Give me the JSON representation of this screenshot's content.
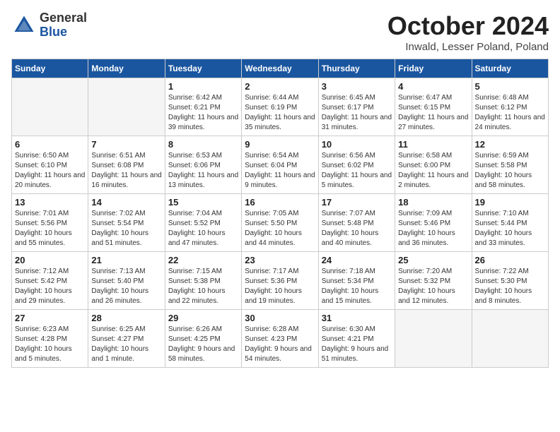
{
  "header": {
    "logo_general": "General",
    "logo_blue": "Blue",
    "month": "October 2024",
    "location": "Inwald, Lesser Poland, Poland"
  },
  "weekdays": [
    "Sunday",
    "Monday",
    "Tuesday",
    "Wednesday",
    "Thursday",
    "Friday",
    "Saturday"
  ],
  "weeks": [
    [
      {
        "day": "",
        "empty": true
      },
      {
        "day": "",
        "empty": true
      },
      {
        "day": "1",
        "sunrise": "Sunrise: 6:42 AM",
        "sunset": "Sunset: 6:21 PM",
        "daylight": "Daylight: 11 hours and 39 minutes."
      },
      {
        "day": "2",
        "sunrise": "Sunrise: 6:44 AM",
        "sunset": "Sunset: 6:19 PM",
        "daylight": "Daylight: 11 hours and 35 minutes."
      },
      {
        "day": "3",
        "sunrise": "Sunrise: 6:45 AM",
        "sunset": "Sunset: 6:17 PM",
        "daylight": "Daylight: 11 hours and 31 minutes."
      },
      {
        "day": "4",
        "sunrise": "Sunrise: 6:47 AM",
        "sunset": "Sunset: 6:15 PM",
        "daylight": "Daylight: 11 hours and 27 minutes."
      },
      {
        "day": "5",
        "sunrise": "Sunrise: 6:48 AM",
        "sunset": "Sunset: 6:12 PM",
        "daylight": "Daylight: 11 hours and 24 minutes."
      }
    ],
    [
      {
        "day": "6",
        "sunrise": "Sunrise: 6:50 AM",
        "sunset": "Sunset: 6:10 PM",
        "daylight": "Daylight: 11 hours and 20 minutes."
      },
      {
        "day": "7",
        "sunrise": "Sunrise: 6:51 AM",
        "sunset": "Sunset: 6:08 PM",
        "daylight": "Daylight: 11 hours and 16 minutes."
      },
      {
        "day": "8",
        "sunrise": "Sunrise: 6:53 AM",
        "sunset": "Sunset: 6:06 PM",
        "daylight": "Daylight: 11 hours and 13 minutes."
      },
      {
        "day": "9",
        "sunrise": "Sunrise: 6:54 AM",
        "sunset": "Sunset: 6:04 PM",
        "daylight": "Daylight: 11 hours and 9 minutes."
      },
      {
        "day": "10",
        "sunrise": "Sunrise: 6:56 AM",
        "sunset": "Sunset: 6:02 PM",
        "daylight": "Daylight: 11 hours and 5 minutes."
      },
      {
        "day": "11",
        "sunrise": "Sunrise: 6:58 AM",
        "sunset": "Sunset: 6:00 PM",
        "daylight": "Daylight: 11 hours and 2 minutes."
      },
      {
        "day": "12",
        "sunrise": "Sunrise: 6:59 AM",
        "sunset": "Sunset: 5:58 PM",
        "daylight": "Daylight: 10 hours and 58 minutes."
      }
    ],
    [
      {
        "day": "13",
        "sunrise": "Sunrise: 7:01 AM",
        "sunset": "Sunset: 5:56 PM",
        "daylight": "Daylight: 10 hours and 55 minutes."
      },
      {
        "day": "14",
        "sunrise": "Sunrise: 7:02 AM",
        "sunset": "Sunset: 5:54 PM",
        "daylight": "Daylight: 10 hours and 51 minutes."
      },
      {
        "day": "15",
        "sunrise": "Sunrise: 7:04 AM",
        "sunset": "Sunset: 5:52 PM",
        "daylight": "Daylight: 10 hours and 47 minutes."
      },
      {
        "day": "16",
        "sunrise": "Sunrise: 7:05 AM",
        "sunset": "Sunset: 5:50 PM",
        "daylight": "Daylight: 10 hours and 44 minutes."
      },
      {
        "day": "17",
        "sunrise": "Sunrise: 7:07 AM",
        "sunset": "Sunset: 5:48 PM",
        "daylight": "Daylight: 10 hours and 40 minutes."
      },
      {
        "day": "18",
        "sunrise": "Sunrise: 7:09 AM",
        "sunset": "Sunset: 5:46 PM",
        "daylight": "Daylight: 10 hours and 36 minutes."
      },
      {
        "day": "19",
        "sunrise": "Sunrise: 7:10 AM",
        "sunset": "Sunset: 5:44 PM",
        "daylight": "Daylight: 10 hours and 33 minutes."
      }
    ],
    [
      {
        "day": "20",
        "sunrise": "Sunrise: 7:12 AM",
        "sunset": "Sunset: 5:42 PM",
        "daylight": "Daylight: 10 hours and 29 minutes."
      },
      {
        "day": "21",
        "sunrise": "Sunrise: 7:13 AM",
        "sunset": "Sunset: 5:40 PM",
        "daylight": "Daylight: 10 hours and 26 minutes."
      },
      {
        "day": "22",
        "sunrise": "Sunrise: 7:15 AM",
        "sunset": "Sunset: 5:38 PM",
        "daylight": "Daylight: 10 hours and 22 minutes."
      },
      {
        "day": "23",
        "sunrise": "Sunrise: 7:17 AM",
        "sunset": "Sunset: 5:36 PM",
        "daylight": "Daylight: 10 hours and 19 minutes."
      },
      {
        "day": "24",
        "sunrise": "Sunrise: 7:18 AM",
        "sunset": "Sunset: 5:34 PM",
        "daylight": "Daylight: 10 hours and 15 minutes."
      },
      {
        "day": "25",
        "sunrise": "Sunrise: 7:20 AM",
        "sunset": "Sunset: 5:32 PM",
        "daylight": "Daylight: 10 hours and 12 minutes."
      },
      {
        "day": "26",
        "sunrise": "Sunrise: 7:22 AM",
        "sunset": "Sunset: 5:30 PM",
        "daylight": "Daylight: 10 hours and 8 minutes."
      }
    ],
    [
      {
        "day": "27",
        "sunrise": "Sunrise: 6:23 AM",
        "sunset": "Sunset: 4:28 PM",
        "daylight": "Daylight: 10 hours and 5 minutes."
      },
      {
        "day": "28",
        "sunrise": "Sunrise: 6:25 AM",
        "sunset": "Sunset: 4:27 PM",
        "daylight": "Daylight: 10 hours and 1 minute."
      },
      {
        "day": "29",
        "sunrise": "Sunrise: 6:26 AM",
        "sunset": "Sunset: 4:25 PM",
        "daylight": "Daylight: 9 hours and 58 minutes."
      },
      {
        "day": "30",
        "sunrise": "Sunrise: 6:28 AM",
        "sunset": "Sunset: 4:23 PM",
        "daylight": "Daylight: 9 hours and 54 minutes."
      },
      {
        "day": "31",
        "sunrise": "Sunrise: 6:30 AM",
        "sunset": "Sunset: 4:21 PM",
        "daylight": "Daylight: 9 hours and 51 minutes."
      },
      {
        "day": "",
        "empty": true
      },
      {
        "day": "",
        "empty": true
      }
    ]
  ]
}
